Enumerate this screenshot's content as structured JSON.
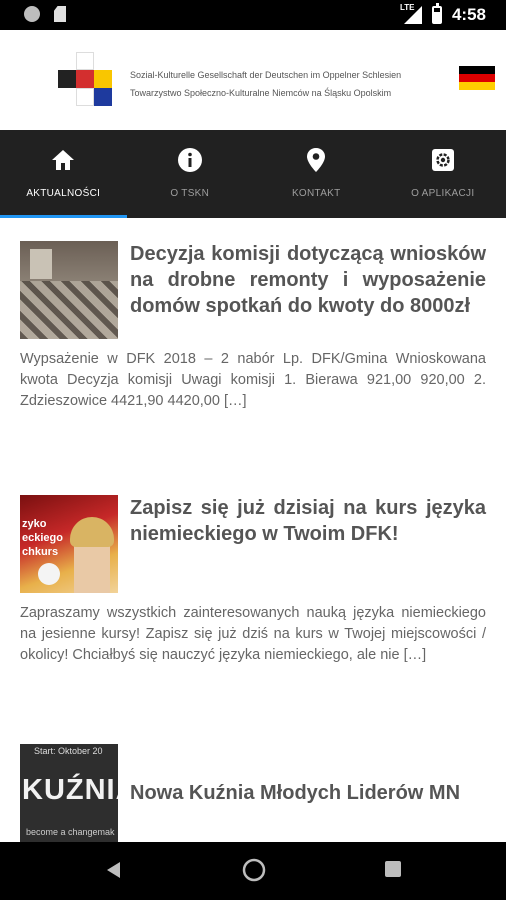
{
  "status_bar": {
    "time": "4:58",
    "network": "LTE",
    "icons": [
      "notification-circle-icon",
      "sd-card-icon",
      "signal-icon",
      "battery-icon"
    ]
  },
  "header": {
    "org_name_de": "Sozial-Kulturelle Gesellschaft der Deutschen im Oppelner Schlesien",
    "org_name_pl": "Towarzystwo Społeczno-Kulturalne Niemców na Śląsku Opolskim",
    "flag": "germany-flag"
  },
  "tabs": [
    {
      "label": "AKTUALNOŚCI",
      "icon": "home-icon",
      "active": true
    },
    {
      "label": "O TSKN",
      "icon": "info-icon",
      "active": false
    },
    {
      "label": "KONTAKT",
      "icon": "location-pin-icon",
      "active": false
    },
    {
      "label": "O APLIKACJI",
      "icon": "settings-icon",
      "active": false
    }
  ],
  "articles": [
    {
      "title": "Decyzja komisji dotyczącą wniosków na drobne remonty i wyposażenie domów spotkań do kwoty do 8000zł",
      "excerpt": "Wypsażenie w DFK 2018 – 2 nabór  Lp. DFK/Gmina Wnioskowana kwota Decyzja komisji Uwagi komisji  1. Bierawa 921,00 920,00     2. Zdzieszowice 4421,90 4420,00 […]"
    },
    {
      "title": "Zapisz się już dzisiaj na kurs języka niemieckiego w Twoim DFK!",
      "excerpt": "Zapraszamy wszystkich zainteresowanych nauką języka niemieckiego na jesienne kursy! Zapisz się już dziś na kurs w Twojej miejscowości / okolicy! Chciałbyś się nauczyć języka niemieckiego, ale nie […]",
      "thumb_text_1": "zyko",
      "thumb_text_2": "eckiego",
      "thumb_text_3": "chkurs"
    },
    {
      "title": "Nowa Kuźnia Młodych Liderów MN",
      "excerpt": "",
      "thumb_top": "Start: Oktober 20",
      "thumb_main": "KUŹNIA",
      "thumb_bottom": "become a changemak"
    }
  ],
  "colors": {
    "tab_bar_bg": "#212121",
    "active_indicator": "#2196f3",
    "title_text": "#555555"
  }
}
